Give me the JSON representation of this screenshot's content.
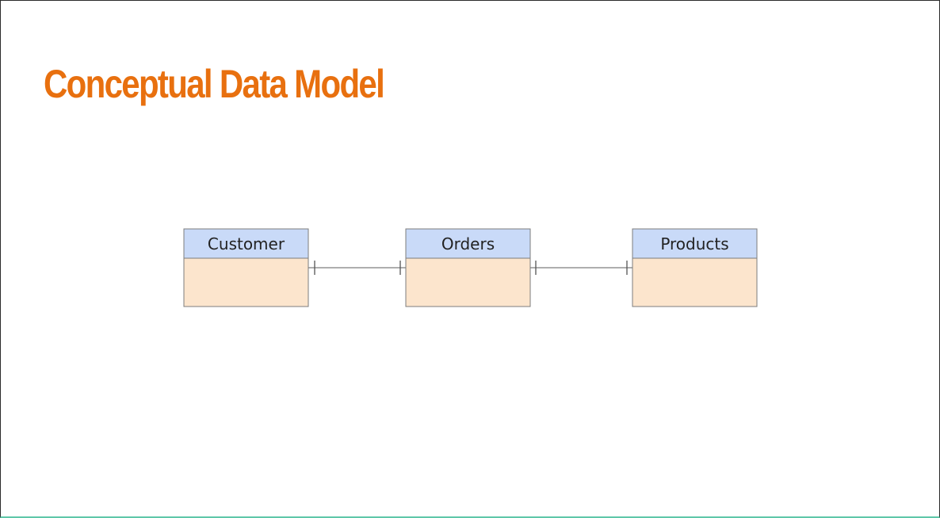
{
  "slide": {
    "title": "Conceptual Data Model"
  },
  "diagram": {
    "colors": {
      "header_fill": "#c9daf8",
      "body_fill": "#fce5cd",
      "border": "#7d7d7d",
      "connector": "#7d7d7d",
      "title": "#e8700f"
    },
    "entities": [
      {
        "name": "Customer"
      },
      {
        "name": "Orders"
      },
      {
        "name": "Products"
      }
    ],
    "relationships": [
      {
        "from": "Customer",
        "to": "Orders",
        "from_end": "one",
        "to_end": "one"
      },
      {
        "from": "Orders",
        "to": "Products",
        "from_end": "one",
        "to_end": "one"
      }
    ]
  }
}
